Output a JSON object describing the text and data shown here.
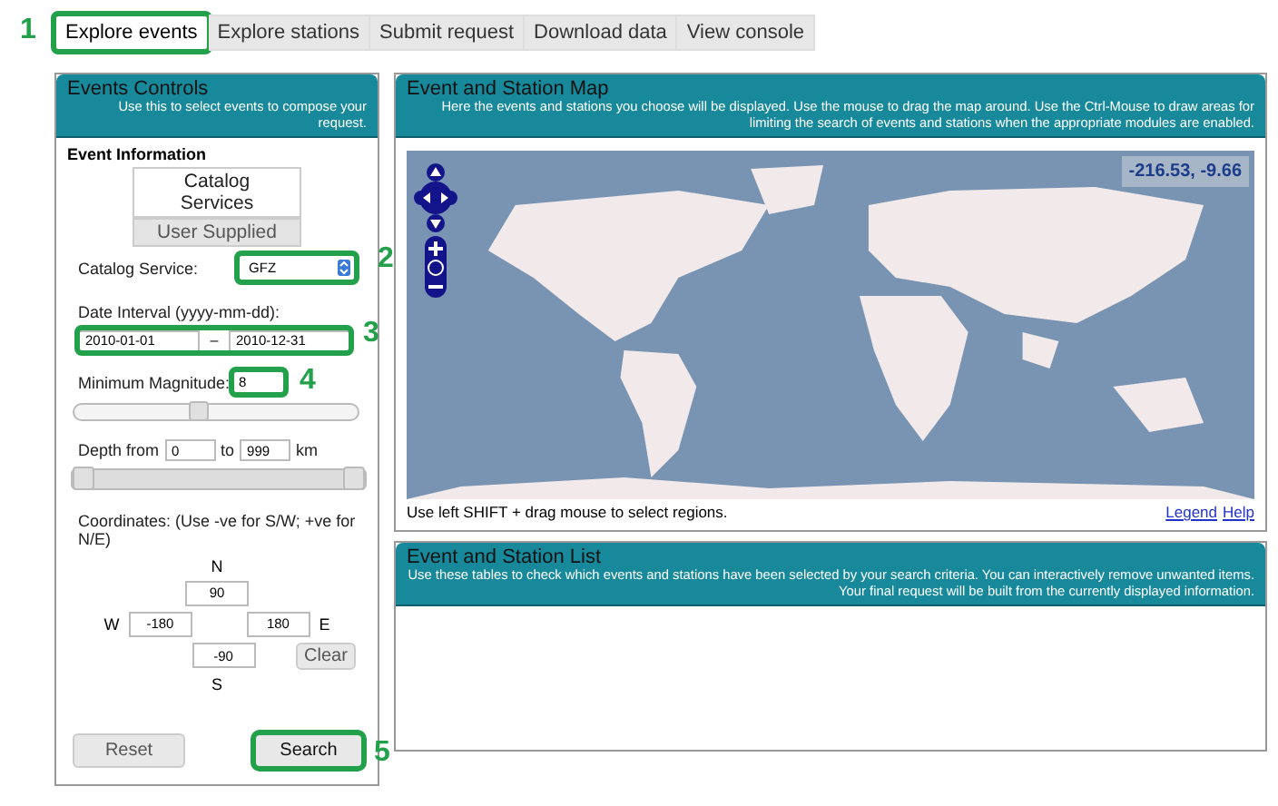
{
  "tabs": [
    {
      "label": "Explore events",
      "selected": true,
      "callout": "1"
    },
    {
      "label": "Explore stations",
      "selected": false
    },
    {
      "label": "Submit request",
      "selected": false
    },
    {
      "label": "Download data",
      "selected": false
    },
    {
      "label": "View console",
      "selected": false
    }
  ],
  "controls": {
    "title": "Events Controls",
    "subtitle": "Use this to select events to compose your request.",
    "section": "Event Information",
    "sources": [
      {
        "label": "Catalog Services",
        "selected": true
      },
      {
        "label": "User Supplied",
        "selected": false
      }
    ],
    "catalog_label": "Catalog Service:",
    "catalog_value": "GFZ",
    "catalog_callout": "2",
    "date_label": "Date Interval (yyyy-mm-dd):",
    "date_from": "2010-01-01",
    "date_sep": "–",
    "date_to": "2010-12-31",
    "date_callout": "3",
    "magnitude_label": "Minimum Magnitude:",
    "magnitude_value": "8",
    "magnitude_callout": "4",
    "magnitude_slider": {
      "level": 0.44
    },
    "depth_from_label": "Depth from",
    "depth_from": "0",
    "depth_to_label": "to",
    "depth_to": "999",
    "depth_unit": "km",
    "depth_slider": {
      "level": 1
    },
    "coords_label": "Coordinates: (Use -ve for S/W; +ve for N/E)",
    "north_label": "N",
    "north": "90",
    "west_label": "W",
    "west": "-180",
    "east": "180",
    "east_label": "E",
    "south": "-90",
    "south_label": "S",
    "clear_button": "Clear",
    "reset_button": "Reset",
    "search_button": "Search",
    "search_callout": "5"
  },
  "map": {
    "title": "Event and Station Map",
    "subtitle": "Here the events and stations you choose will be displayed. Use the mouse to drag the map around. Use the Ctrl-Mouse to draw areas for limiting the search of events and stations when the appropriate modules are enabled.",
    "coordinates": "-216.53, -9.66",
    "hint": "Use left SHIFT + drag mouse to select regions.",
    "links": [
      "Legend",
      "Help"
    ]
  },
  "list": {
    "title": "Event and Station List",
    "subtitle": "Use these tables to check which events and stations have been selected by your search criteria. You can interactively remove unwanted items. Your final request will be built from the currently displayed information."
  }
}
